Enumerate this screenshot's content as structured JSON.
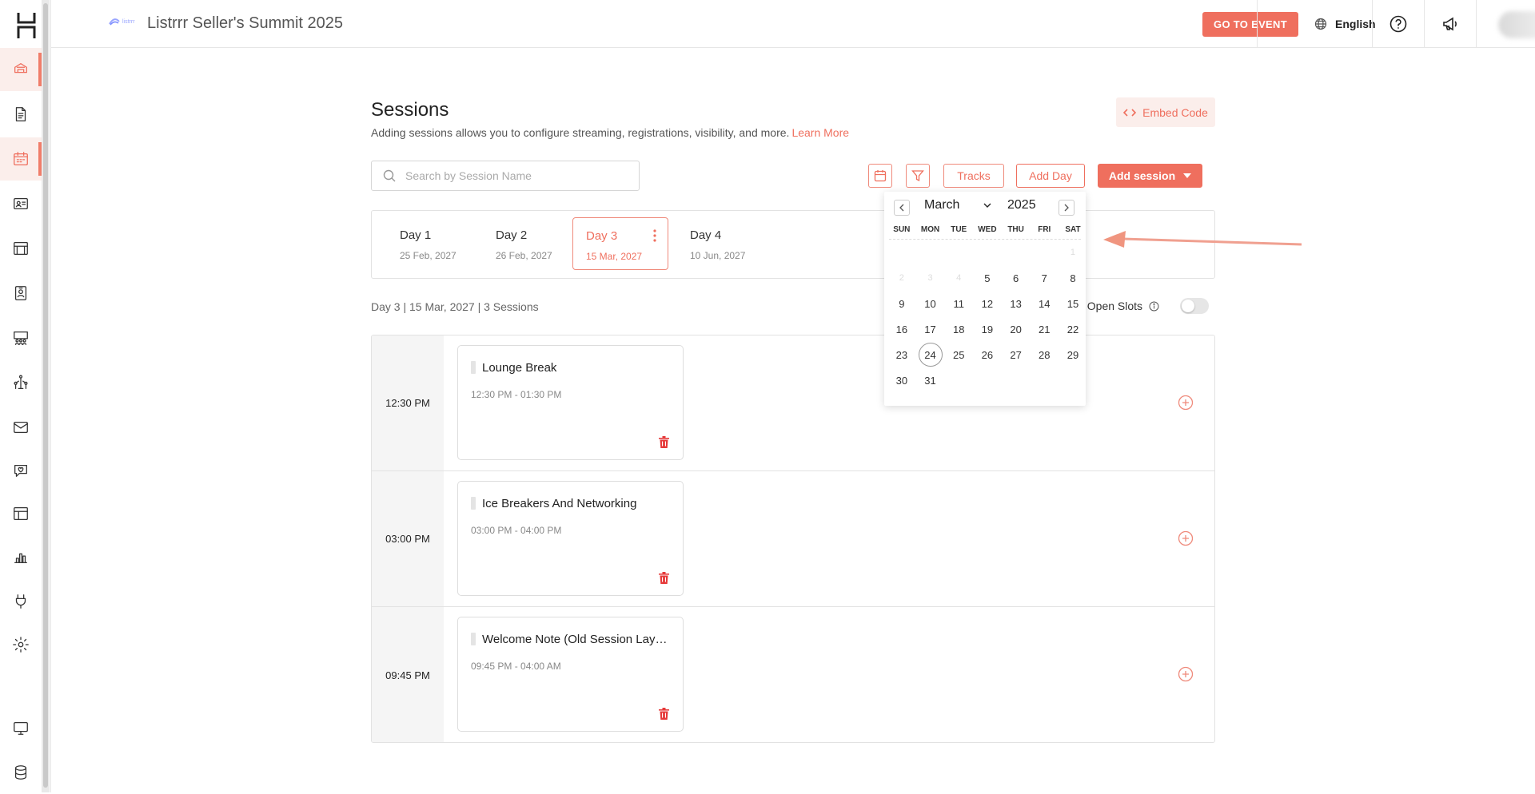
{
  "header": {
    "event_title": "Listrrr Seller's Summit 2025",
    "event_logo_text": "listrrr",
    "go_to_event": "GO TO EVENT",
    "language": "English"
  },
  "sidebar": {
    "items": [
      {
        "icon": "home-icon",
        "active": true
      },
      {
        "icon": "document-icon",
        "active": false
      },
      {
        "icon": "calendar-icon",
        "active": true
      },
      {
        "icon": "id-card-icon",
        "active": false
      },
      {
        "icon": "booth-icon",
        "active": false
      },
      {
        "icon": "badge-icon",
        "active": false
      },
      {
        "icon": "people-screen-icon",
        "active": false
      },
      {
        "icon": "networking-icon",
        "active": false
      },
      {
        "icon": "mail-icon",
        "active": false
      },
      {
        "icon": "chat-heart-icon",
        "active": false
      },
      {
        "icon": "layout-icon",
        "active": false
      },
      {
        "icon": "analytics-icon",
        "active": false
      },
      {
        "icon": "plug-icon",
        "active": false
      },
      {
        "icon": "settings-icon",
        "active": false
      },
      {
        "icon": "monitor-icon",
        "active": false
      },
      {
        "icon": "database-icon",
        "active": false
      }
    ]
  },
  "page": {
    "title": "Sessions",
    "subtitle": "Adding sessions allows you to configure streaming, registrations, visibility, and more.",
    "learn_more": "Learn More",
    "embed_code": "Embed Code"
  },
  "toolbar": {
    "search_placeholder": "Search by Session Name",
    "tracks": "Tracks",
    "add_day": "Add Day",
    "add_session": "Add session"
  },
  "days": [
    {
      "name": "Day 1",
      "date": "25 Feb, 2027"
    },
    {
      "name": "Day 2",
      "date": "26 Feb, 2027"
    },
    {
      "name": "Day 3",
      "date": "15 Mar, 2027"
    },
    {
      "name": "Day 4",
      "date": "10 Jun, 2027"
    }
  ],
  "active_day_index": 2,
  "day_summary": "Day 3 | 15 Mar, 2027 | 3 Sessions",
  "open_slots_label": "ow Open Slots",
  "open_slots_enabled": false,
  "slots": [
    {
      "time": "12:30 PM",
      "session_title": "Lounge Break",
      "session_time": "12:30 PM - 01:30 PM"
    },
    {
      "time": "03:00 PM",
      "session_title": "Ice Breakers And Networking",
      "session_time": "03:00 PM - 04:00 PM"
    },
    {
      "time": "09:45 PM",
      "session_title": "Welcome Note (Old Session Lay…",
      "session_time": "09:45 PM - 04:00 AM"
    }
  ],
  "datepicker": {
    "month": "March",
    "year": "2025",
    "weekdays": [
      "SUN",
      "MON",
      "TUE",
      "WED",
      "THU",
      "FRI",
      "SAT"
    ],
    "leading_faint_row": [
      "",
      "",
      "",
      "",
      "",
      "",
      "1"
    ],
    "faint_row_2": [
      "2",
      "3",
      "4"
    ],
    "weeks": [
      [
        "2",
        "3",
        "4",
        "5",
        "6",
        "7",
        "8"
      ],
      [
        "9",
        "10",
        "11",
        "12",
        "13",
        "14",
        "15"
      ],
      [
        "16",
        "17",
        "18",
        "19",
        "20",
        "21",
        "22"
      ],
      [
        "23",
        "24",
        "25",
        "26",
        "27",
        "28",
        "29"
      ],
      [
        "30",
        "31",
        "",
        "",
        "",
        "",
        ""
      ]
    ],
    "highlighted_day": "24"
  },
  "colors": {
    "accent": "#ef6f5e",
    "accent_light": "#fbeeeb"
  }
}
